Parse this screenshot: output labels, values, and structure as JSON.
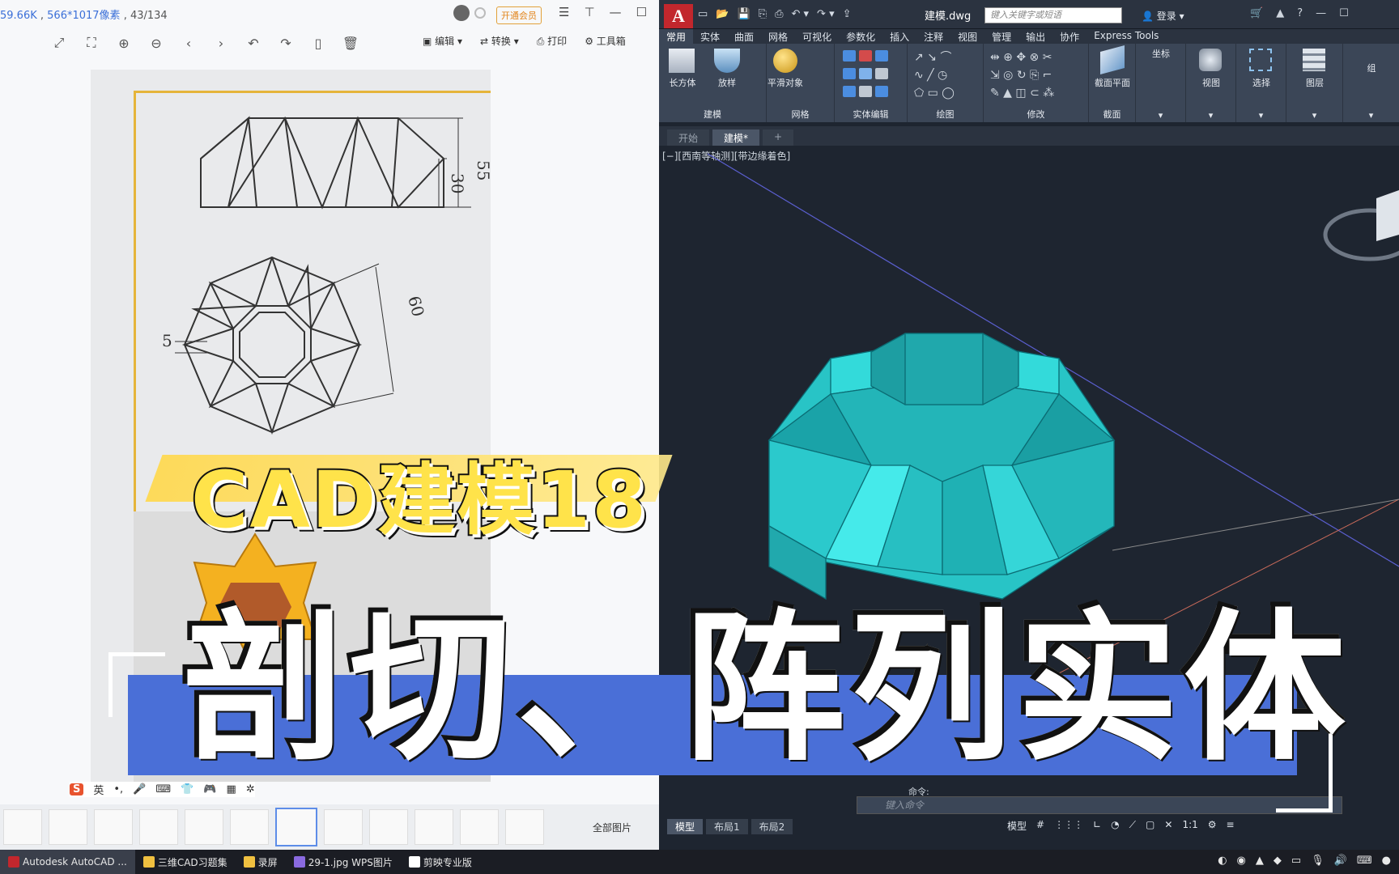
{
  "wps": {
    "status_size": "59.66K",
    "status_dims": "566*1017像素",
    "status_page": "43/134",
    "vip_label": "开通会员",
    "edit_label": "编辑",
    "convert_label": "转换",
    "print_label": "打印",
    "toolbox_label": "工具箱",
    "all_pictures": "全部图片",
    "drawing_dims": {
      "d55": "55",
      "d30": "30",
      "d5": "5",
      "d60": "60"
    },
    "ime": {
      "s": "S",
      "lang": "英"
    },
    "thumbnail_count": 12,
    "selected_thumbnail": 6
  },
  "acad": {
    "logo": "A",
    "file_title": "建模.dwg",
    "search_placeholder": "键入关键字或短语",
    "login": "登录",
    "tabs": [
      "常用",
      "实体",
      "曲面",
      "网格",
      "可视化",
      "参数化",
      "插入",
      "注释",
      "视图",
      "管理",
      "输出",
      "协作",
      "Express Tools"
    ],
    "active_tab": "常用",
    "panels": [
      {
        "label": "建模",
        "items": [
          "长方体",
          "放样"
        ]
      },
      {
        "label": "网格",
        "items": [
          "平滑对象"
        ]
      },
      {
        "label": "实体编辑",
        "items": []
      },
      {
        "label": "绘图",
        "items": []
      },
      {
        "label": "修改",
        "items": []
      },
      {
        "label": "截面",
        "items": [
          "截面平面"
        ]
      },
      {
        "label": "坐标",
        "items": []
      },
      {
        "label": "视图",
        "items": []
      },
      {
        "label": "选择",
        "items": []
      },
      {
        "label": "图层",
        "items": []
      },
      {
        "label": "组",
        "items": []
      }
    ],
    "doc_tabs": [
      "开始",
      "建模*"
    ],
    "active_doc_tab": "建模*",
    "viewport_label": "[−][西南等轴测][带边缘着色]",
    "cmd_label": "命令:",
    "cmd_placeholder": "键入命令",
    "layout_tabs": [
      "模型",
      "布局1",
      "布局2"
    ],
    "status": {
      "model": "模型",
      "scale": "1:1"
    },
    "solid_color": "#3fe3e3"
  },
  "taskbar": {
    "items": [
      "Autodesk AutoCAD ...",
      "三维CAD习题集",
      "录屏",
      "29-1.jpg  WPS图片",
      "剪映专业版"
    ]
  },
  "overlay": {
    "subtitle": "CAD建模18",
    "title": "剖切、阵列实体"
  }
}
